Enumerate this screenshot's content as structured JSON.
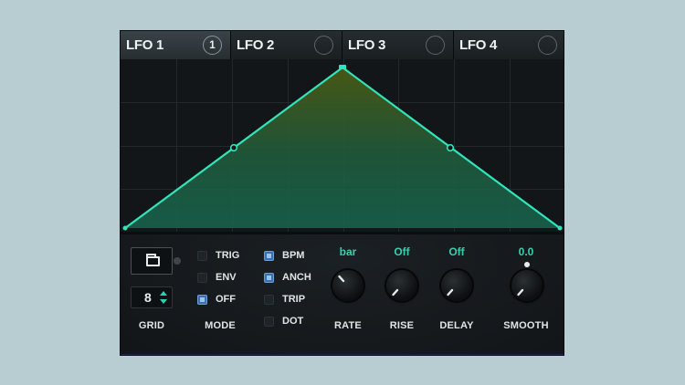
{
  "tabs": [
    {
      "label": "LFO 1",
      "badge": "1",
      "active": true
    },
    {
      "label": "LFO 2",
      "badge": "",
      "active": false
    },
    {
      "label": "LFO 3",
      "badge": "",
      "active": false
    },
    {
      "label": "LFO 4",
      "badge": "",
      "active": false
    }
  ],
  "colors": {
    "accent": "#2fe0b8",
    "waveform": "#33e3bb",
    "checkbox_on": "#3a6fb0",
    "background": "#b8cdd2"
  },
  "grid": {
    "value": "8",
    "label": "GRID"
  },
  "mode": {
    "label": "MODE",
    "options": [
      {
        "label": "TRIG",
        "checked": false
      },
      {
        "label": "ENV",
        "checked": false
      },
      {
        "label": "OFF",
        "checked": true
      }
    ]
  },
  "timing": {
    "options": [
      {
        "label": "BPM",
        "checked": true
      },
      {
        "label": "ANCH",
        "checked": true
      },
      {
        "label": "TRIP",
        "checked": false
      },
      {
        "label": "DOT",
        "checked": false
      }
    ]
  },
  "knobs": {
    "rate": {
      "label": "RATE",
      "value": "bar"
    },
    "rise": {
      "label": "RISE",
      "value": "Off"
    },
    "delay": {
      "label": "DELAY",
      "value": "Off"
    },
    "smooth": {
      "label": "SMOOTH",
      "value": "0.0"
    }
  },
  "icons": {
    "preset": "folder-icon",
    "stepper_up": "arrow-up-icon",
    "stepper_down": "arrow-down-icon"
  }
}
